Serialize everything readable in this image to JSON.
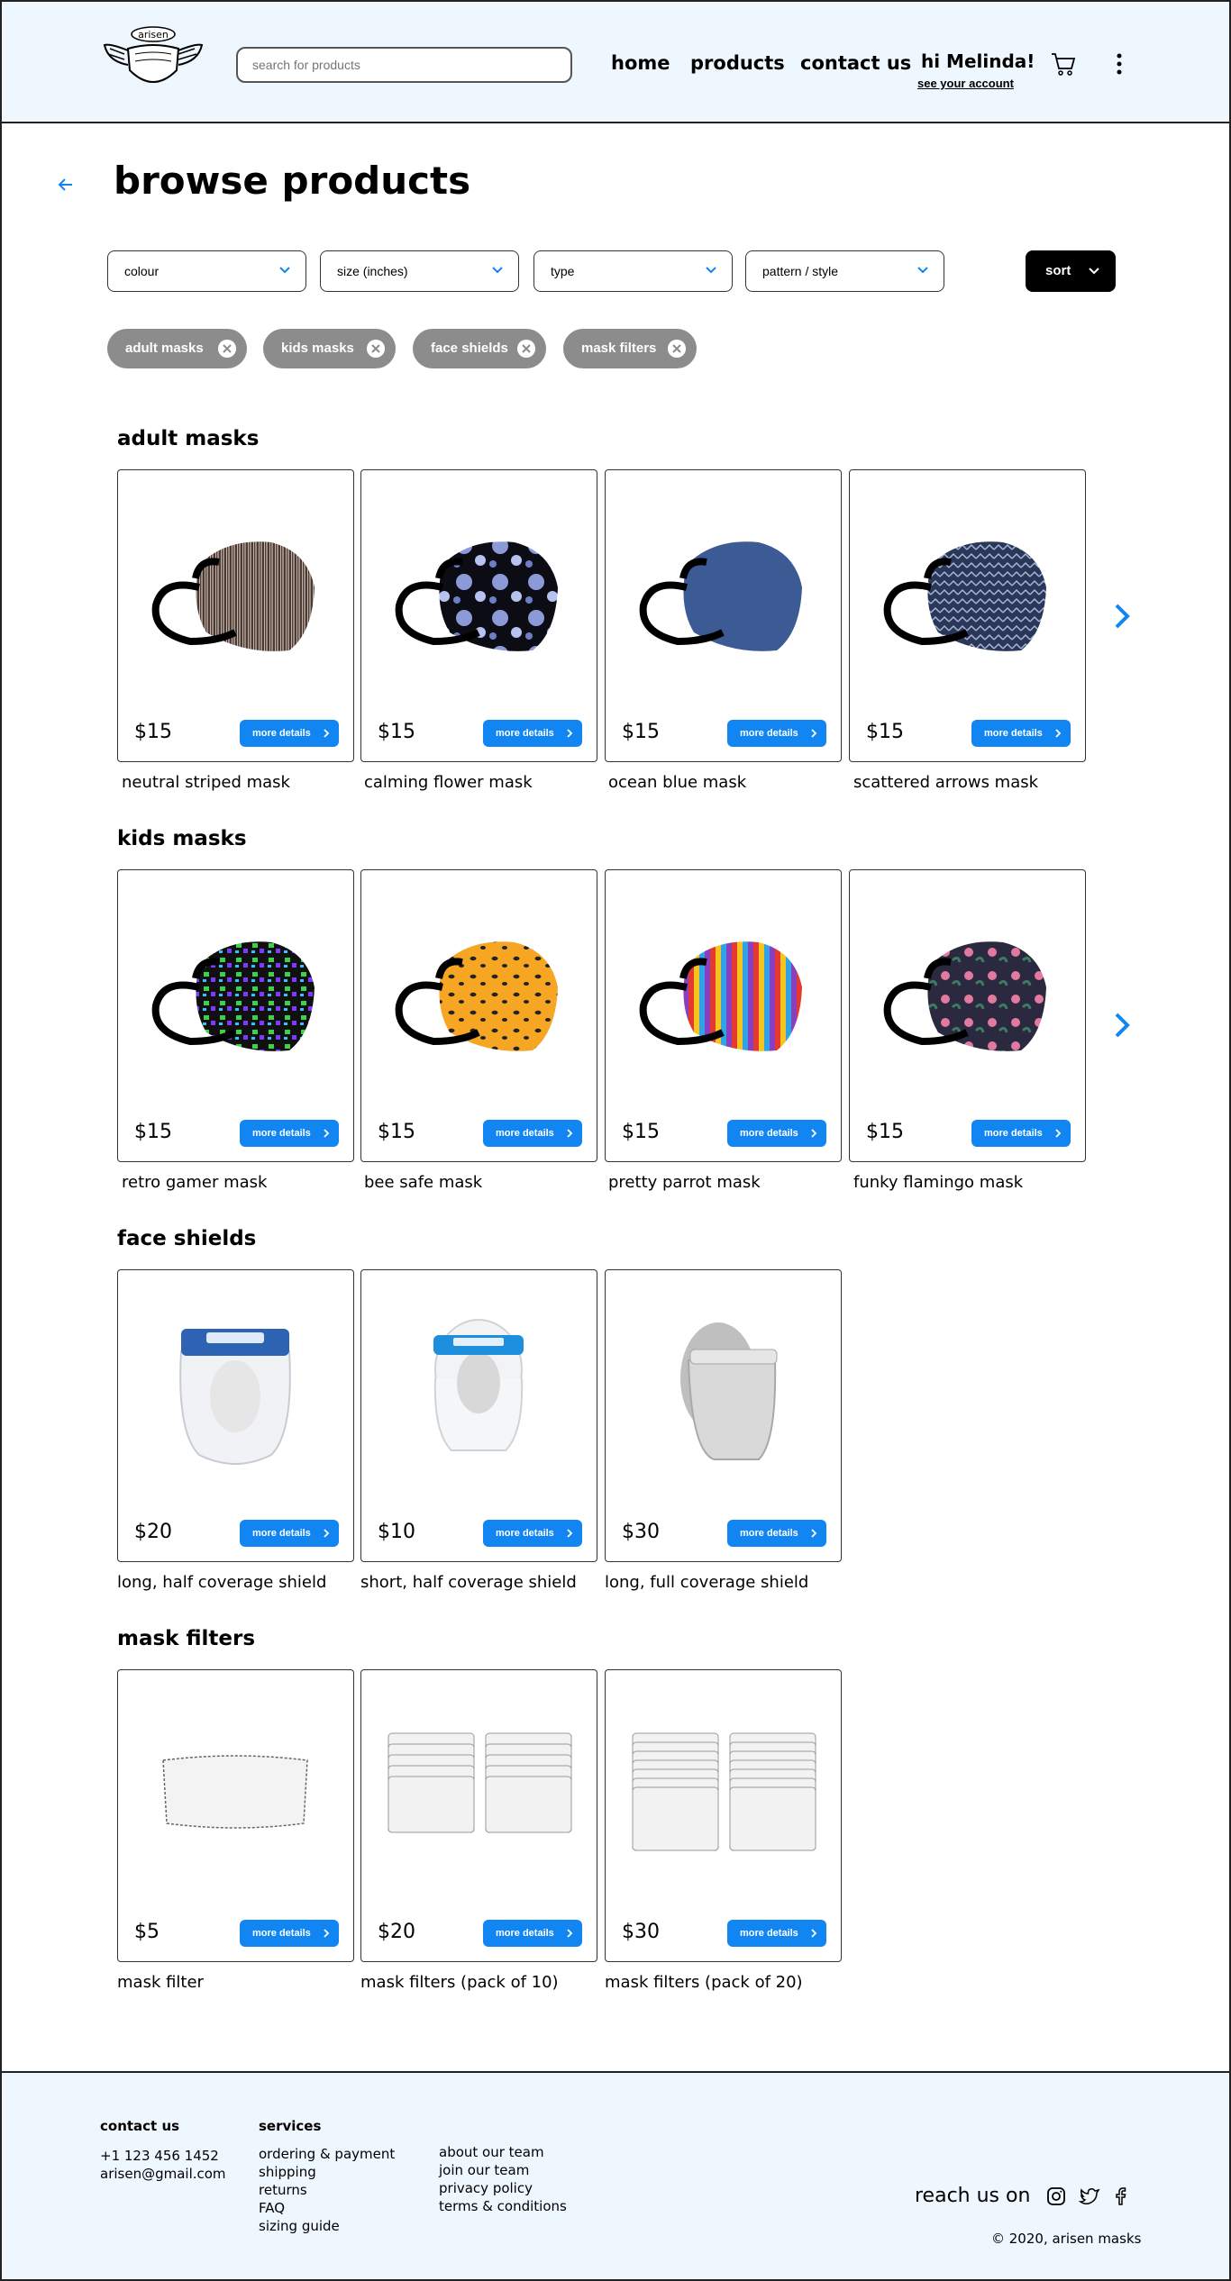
{
  "header": {
    "search_placeholder": "search for products",
    "nav": [
      "home",
      "products",
      "contact us"
    ],
    "greeting": "hi Melinda!",
    "account_link": "see your account",
    "logo_text": "arisen"
  },
  "page": {
    "title": "browse products"
  },
  "filters": [
    "colour",
    "size (inches)",
    "type",
    "pattern / style"
  ],
  "sort_label": "sort",
  "chips": [
    "adult masks",
    "kids masks",
    "face shields",
    "mask filters"
  ],
  "more_label": "more details",
  "sections": [
    {
      "title": "adult masks",
      "products": [
        {
          "name": "neutral striped mask",
          "price": "$15"
        },
        {
          "name": "calming flower mask",
          "price": "$15"
        },
        {
          "name": "ocean blue mask",
          "price": "$15"
        },
        {
          "name": "scattered arrows mask",
          "price": "$15"
        }
      ]
    },
    {
      "title": "kids masks",
      "products": [
        {
          "name": "retro gamer mask",
          "price": "$15"
        },
        {
          "name": "bee safe mask",
          "price": "$15"
        },
        {
          "name": "pretty parrot mask",
          "price": "$15"
        },
        {
          "name": "funky flamingo mask",
          "price": "$15"
        }
      ]
    },
    {
      "title": "face shields",
      "products": [
        {
          "name": "long, half coverage shield",
          "price": "$20"
        },
        {
          "name": "short, half coverage shield",
          "price": "$10"
        },
        {
          "name": "long, full coverage shield",
          "price": "$30"
        }
      ]
    },
    {
      "title": "mask filters",
      "products": [
        {
          "name": "mask filter",
          "price": "$5"
        },
        {
          "name": "mask filters (pack of 10)",
          "price": "$20"
        },
        {
          "name": "mask filters (pack of 20)",
          "price": "$30"
        }
      ]
    }
  ],
  "footer": {
    "contact_heading": "contact us",
    "phone": "+1 123 456 1452",
    "email": "arisen@gmail.com",
    "services_heading": "services",
    "services": [
      "ordering & payment",
      "shipping",
      "returns",
      "FAQ",
      "sizing guide"
    ],
    "about": [
      "about our team",
      "join our team",
      "privacy policy",
      "terms & conditions"
    ],
    "reach_us": "reach us on",
    "copyright": "© 2020, arisen masks"
  },
  "colors": {
    "accent": "#1185f2",
    "header_bg": "#eef6fe",
    "chip_bg": "#8c8c8c"
  }
}
